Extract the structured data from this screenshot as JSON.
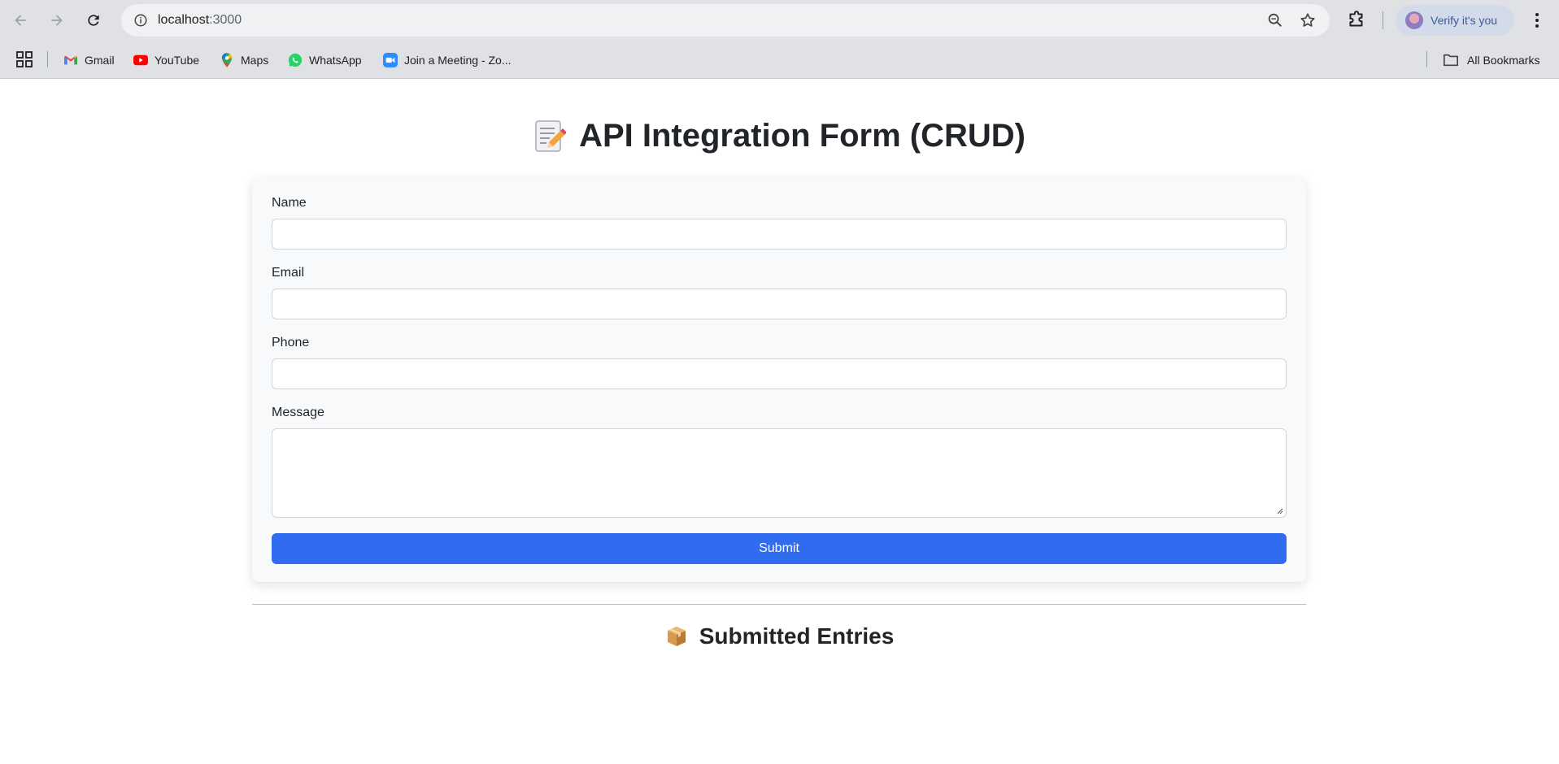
{
  "browser": {
    "url_host": "localhost",
    "url_port": ":3000",
    "profile_label": "Verify it's you",
    "bookmarks": [
      {
        "label": "Gmail",
        "icon": "gmail-icon"
      },
      {
        "label": "YouTube",
        "icon": "youtube-icon"
      },
      {
        "label": "Maps",
        "icon": "maps-icon"
      },
      {
        "label": "WhatsApp",
        "icon": "whatsapp-icon"
      },
      {
        "label": "Join a Meeting - Zo...",
        "icon": "zoom-icon"
      }
    ],
    "all_bookmarks_label": "All Bookmarks"
  },
  "page": {
    "title": "API Integration Form (CRUD)",
    "form": {
      "name_label": "Name",
      "name_value": "",
      "email_label": "Email",
      "email_value": "",
      "phone_label": "Phone",
      "phone_value": "",
      "message_label": "Message",
      "message_value": "",
      "submit_label": "Submit"
    },
    "entries_heading": "Submitted Entries"
  },
  "colors": {
    "primary": "#2f6cf0",
    "card_background": "#f8f9fa",
    "chrome_background": "#dfe1e5"
  }
}
